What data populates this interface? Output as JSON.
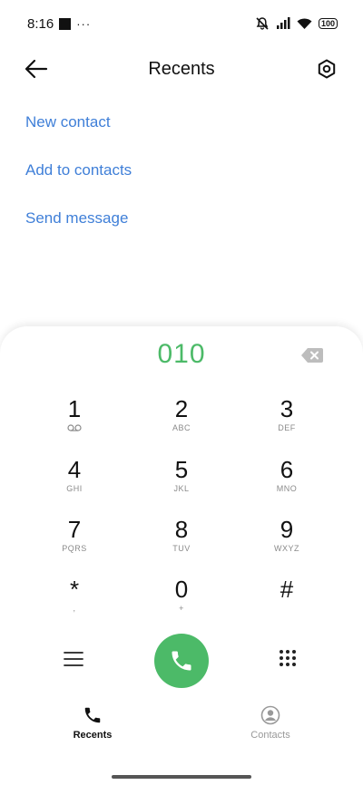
{
  "status_bar": {
    "time": "8:16",
    "more": "···",
    "battery": "100"
  },
  "header": {
    "title": "Recents",
    "back_icon": "arrow-left-icon",
    "settings_icon": "hexagon-settings-icon"
  },
  "actions": [
    {
      "label": "New contact"
    },
    {
      "label": "Add to contacts"
    },
    {
      "label": "Send message"
    }
  ],
  "dialer": {
    "number": "010",
    "keys": [
      {
        "digit": "1",
        "letters": ""
      },
      {
        "digit": "2",
        "letters": "ABC"
      },
      {
        "digit": "3",
        "letters": "DEF"
      },
      {
        "digit": "4",
        "letters": "GHI"
      },
      {
        "digit": "5",
        "letters": "JKL"
      },
      {
        "digit": "6",
        "letters": "MNO"
      },
      {
        "digit": "7",
        "letters": "PQRS"
      },
      {
        "digit": "8",
        "letters": "TUV"
      },
      {
        "digit": "9",
        "letters": "WXYZ"
      },
      {
        "digit": "*",
        "letters": ","
      },
      {
        "digit": "0",
        "letters": "+"
      },
      {
        "digit": "#",
        "letters": ""
      }
    ]
  },
  "bottom_nav": {
    "recents": "Recents",
    "contacts": "Contacts"
  },
  "colors": {
    "accent_link": "#3f7fd8",
    "call_green": "#4cba68"
  }
}
